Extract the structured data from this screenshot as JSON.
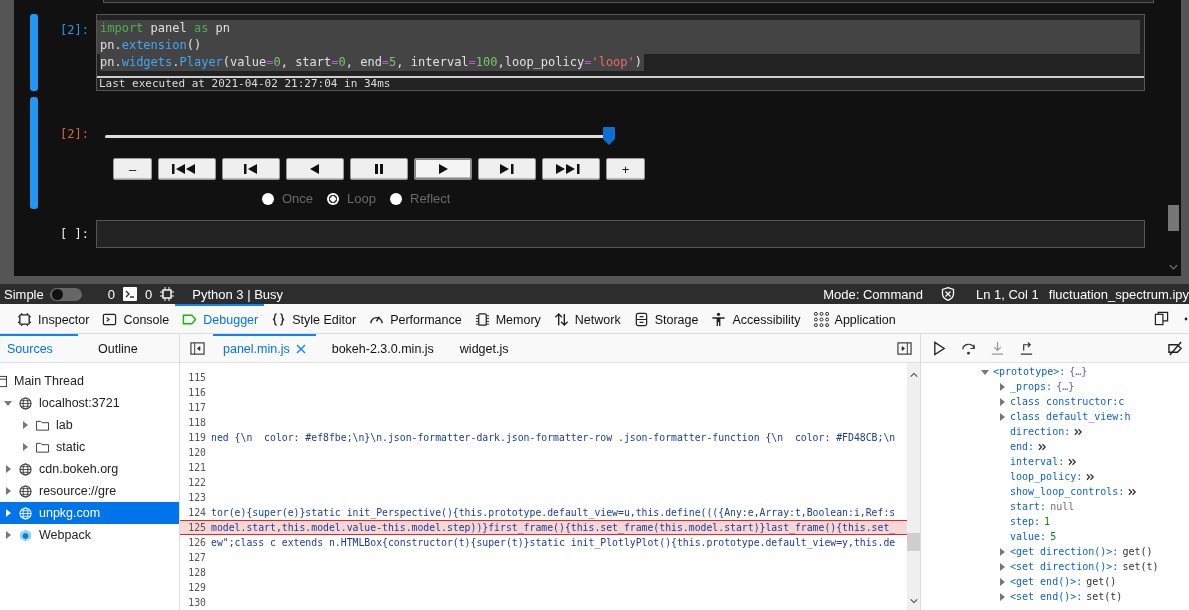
{
  "notebook": {
    "cells": [
      {
        "kind": "code",
        "prompt": "[2]:",
        "selected": true,
        "code": [
          [
            {
              "kind": "keyword",
              "t": "import"
            },
            {
              "kind": "plain",
              "t": " panel "
            },
            {
              "kind": "keyword",
              "t": "as"
            },
            {
              "kind": "plain",
              "t": " pn"
            }
          ],
          [
            {
              "kind": "plain",
              "t": "pn."
            },
            {
              "kind": "attr",
              "t": "extension"
            },
            {
              "kind": "plain",
              "t": "()"
            }
          ],
          [
            {
              "kind": "plain",
              "t": "pn."
            },
            {
              "kind": "attr",
              "t": "widgets"
            },
            {
              "kind": "plain",
              "t": "."
            },
            {
              "kind": "attr",
              "t": "Player"
            },
            {
              "kind": "plain",
              "t": "(value"
            },
            {
              "kind": "op",
              "t": "="
            },
            {
              "kind": "number",
              "t": "0"
            },
            {
              "kind": "plain",
              "t": ", start"
            },
            {
              "kind": "op",
              "t": "="
            },
            {
              "kind": "number",
              "t": "0"
            },
            {
              "kind": "plain",
              "t": ", end"
            },
            {
              "kind": "op",
              "t": "="
            },
            {
              "kind": "number",
              "t": "5"
            },
            {
              "kind": "plain",
              "t": ", interval"
            },
            {
              "kind": "op",
              "t": "="
            },
            {
              "kind": "number",
              "t": "100"
            },
            {
              "kind": "plain",
              "t": ",loop_policy"
            },
            {
              "kind": "op",
              "t": "="
            },
            {
              "kind": "string",
              "t": "'loop'"
            },
            {
              "kind": "plain",
              "t": ")"
            }
          ]
        ],
        "execution_note": "Last executed at 2021-04-02 21:27:04 in 34ms"
      },
      {
        "kind": "player",
        "prompt": "[2]:",
        "level": 1,
        "buttons": [
          {
            "kind": "text",
            "label": "–",
            "pressed": false
          },
          {
            "kind": "first",
            "pressed": false
          },
          {
            "kind": "previous",
            "pressed": false
          },
          {
            "kind": "reverse",
            "pressed": false
          },
          {
            "kind": "pause",
            "pressed": false
          },
          {
            "kind": "play",
            "pressed": true
          },
          {
            "kind": "next",
            "pressed": false
          },
          {
            "kind": "last",
            "pressed": false
          },
          {
            "kind": "text",
            "label": "+",
            "pressed": false
          }
        ],
        "loop_options": [
          {
            "label": "Once",
            "selected": false
          },
          {
            "label": "Loop",
            "selected": true
          },
          {
            "label": "Reflect",
            "selected": false
          }
        ]
      },
      {
        "kind": "input",
        "prompt": "[ ]:"
      }
    ]
  },
  "status_bar": {
    "simple_label": "Simple",
    "simple_on": false,
    "kernel_count": "0",
    "terminal_count": "0",
    "kernel": "Python 3 | Busy",
    "mode": "Mode: Command",
    "cursor": "Ln 1, Col 1",
    "file": "fluctuation_spectrum.ipy"
  },
  "devtools": {
    "tabs": [
      {
        "kind": "inspector",
        "label": "Inspector",
        "selected": false
      },
      {
        "kind": "console",
        "label": "Console",
        "selected": false
      },
      {
        "kind": "debugger",
        "label": "Debugger",
        "selected": true
      },
      {
        "kind": "style",
        "label": "Style Editor",
        "selected": false
      },
      {
        "kind": "performance",
        "label": "Performance",
        "selected": false
      },
      {
        "kind": "memory",
        "label": "Memory",
        "selected": false
      },
      {
        "kind": "network",
        "label": "Network",
        "selected": false
      },
      {
        "kind": "storage",
        "label": "Storage",
        "selected": false
      },
      {
        "kind": "accessibility",
        "label": "Accessibility",
        "selected": false
      },
      {
        "kind": "application",
        "label": "Application",
        "selected": false
      }
    ],
    "sidebar_tabs": [
      {
        "label": "Sources",
        "selected": true
      },
      {
        "label": "Outline",
        "selected": false
      }
    ],
    "sources_tree": [
      {
        "kind": "thread",
        "label": "Main Thread",
        "selected": false,
        "children": [
          {
            "kind": "host",
            "label": "localhost:3721",
            "expanded": true,
            "selected": false,
            "children": [
              {
                "kind": "folder",
                "label": "lab",
                "expanded": false,
                "selected": false
              },
              {
                "kind": "folder",
                "label": "static",
                "expanded": false,
                "selected": false
              }
            ]
          },
          {
            "kind": "host",
            "label": "cdn.bokeh.org",
            "expanded": false,
            "selected": false
          },
          {
            "kind": "host",
            "label": "resource://gre",
            "expanded": false,
            "selected": false
          },
          {
            "kind": "host",
            "label": "unpkg.com",
            "expanded": false,
            "selected": true
          },
          {
            "kind": "webpack",
            "label": "Webpack",
            "expanded": false,
            "selected": false
          }
        ]
      }
    ],
    "editor_tabs": [
      {
        "label": "panel.min.js",
        "selected": true,
        "closable": true
      },
      {
        "label": "bokeh-2.3.0.min.js",
        "selected": false,
        "closable": false
      },
      {
        "label": "widget.js",
        "selected": false,
        "closable": false
      }
    ],
    "code_lines": [
      {
        "number": "115",
        "highlighted": false
      },
      {
        "number": "116",
        "highlighted": false
      },
      {
        "number": "117",
        "highlighted": false
      },
      {
        "number": "118",
        "highlighted": false
      },
      {
        "number": "119",
        "highlighted": false,
        "code": "ned {\\n  color: #ef8fbe;\\n}\\n.json-formatter-dark.json-formatter-row .json-formatter-function {\\n  color: #FD48CB;\\n"
      },
      {
        "number": "120",
        "highlighted": false
      },
      {
        "number": "121",
        "highlighted": false
      },
      {
        "number": "122",
        "highlighted": false
      },
      {
        "number": "123",
        "highlighted": false
      },
      {
        "number": "124",
        "highlighted": false,
        "code": "tor(e){super(e)}static init_Perspective(){this.prototype.default_view=u,this.define((({Any:e,Array:t,Boolean:i,Ref:s"
      },
      {
        "number": "125",
        "highlighted": true,
        "code": "model.start,this.model.value-this.model.step))}first_frame(){this.set_frame(this.model.start)}last_frame(){this.set_"
      },
      {
        "number": "126",
        "highlighted": false,
        "code": "ew\";class c extends n.HTMLBox{constructor(t){super(t)}static init_PlotlyPlot(){this.prototype.default_view=y,this.de"
      },
      {
        "number": "127",
        "highlighted": false
      },
      {
        "number": "128",
        "highlighted": false
      },
      {
        "number": "129",
        "highlighted": false
      },
      {
        "number": "130",
        "highlighted": false
      }
    ],
    "scopes": [
      {
        "name": "<prototype>:",
        "value": "{…}",
        "kind": "object",
        "expanded": true,
        "children": [
          {
            "name": "_props:",
            "value": "{…}",
            "kind": "object",
            "expanded": false
          },
          {
            "name": "class constructor:c",
            "kind": "class",
            "expanded": false
          },
          {
            "name": "class default_view:h",
            "kind": "class",
            "expanded": false
          },
          {
            "name": "direction:",
            "kind": "getter"
          },
          {
            "name": "end:",
            "kind": "getter"
          },
          {
            "name": "interval:",
            "kind": "getter"
          },
          {
            "name": "loop_policy:",
            "kind": "getter"
          },
          {
            "name": "show_loop_controls:",
            "kind": "getter"
          },
          {
            "name": "start:",
            "value": "null",
            "kind": "null"
          },
          {
            "name": "step:",
            "value": "1",
            "kind": "number"
          },
          {
            "name": "value:",
            "value": "5",
            "kind": "number"
          },
          {
            "name": "<get direction()>:",
            "value": "get()",
            "kind": "function",
            "expanded": false
          },
          {
            "name": "<set direction()>:",
            "value": "set(t)",
            "kind": "function",
            "expanded": false
          },
          {
            "name": "<get end()>:",
            "value": "get()",
            "kind": "function",
            "expanded": false
          },
          {
            "name": "<set end()>:",
            "value": "set(t)",
            "kind": "function",
            "expanded": false
          }
        ]
      }
    ]
  }
}
